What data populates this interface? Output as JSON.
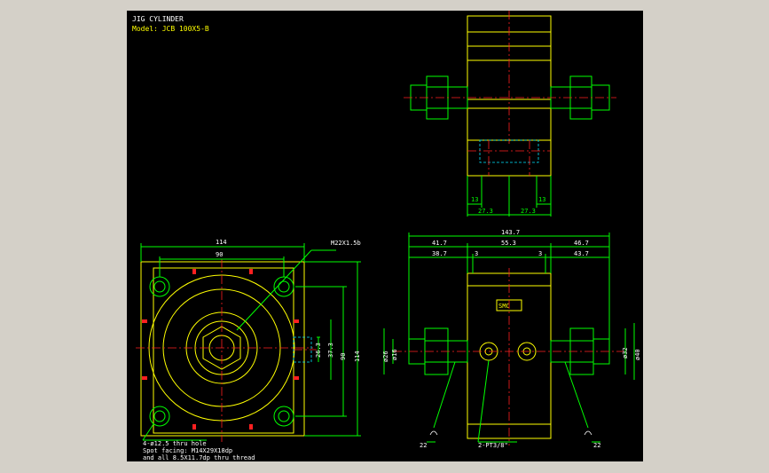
{
  "title": {
    "name": "JIG CYLINDER",
    "model": "Model: JCB 100X5-B"
  },
  "dims": {
    "top_left_13": "13",
    "top_right_13": "13",
    "top_left_273": "27.3",
    "top_right_273": "27.3",
    "overall_width": "114",
    "bolt_pitch": "90",
    "port_label": "M22X1.5b",
    "port_h1": "26.3",
    "port_h2": "37.3",
    "side_90": "90",
    "side_114": "114",
    "total_length": "143.7",
    "seg_417": "41.7",
    "seg_553": "55.3",
    "seg_467": "46.7",
    "seg_387": "38.7",
    "seg_3a": "3",
    "seg_3b": "3",
    "seg_437": "43.7",
    "dia_left_a": "ø26",
    "dia_left_b": "ø16",
    "dia_left_c": "ø35",
    "dia_right_a": "ø32",
    "dia_right_b": "ø40",
    "bottom_22_left": "22",
    "bottom_22_right": "22",
    "pt_label": "2-PT3/8\""
  },
  "notes": {
    "line1": "4-ø12.5 thru hole",
    "line2": "Spot facing: M14X29X18dp",
    "line3": "and all 8.5X11.7dp thru thread"
  },
  "body_label": "SMC"
}
